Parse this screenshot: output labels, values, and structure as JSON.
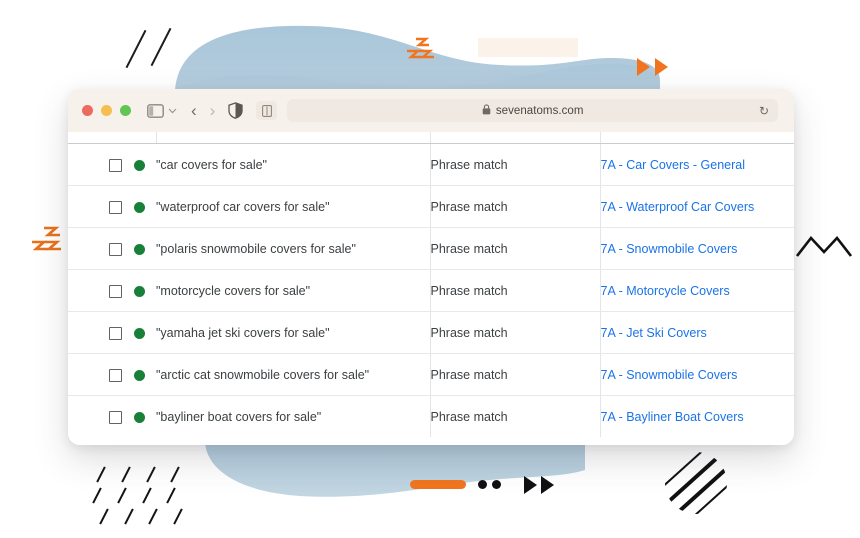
{
  "browser": {
    "traffic_lights": [
      "close",
      "minimize",
      "zoom"
    ],
    "sidebar_toggle_icon": "sidebar-icon",
    "chevron_icon": "chevron-down-icon",
    "back_label": "‹",
    "forward_label": "›",
    "shield_icon": "shield-icon",
    "reader_icon": "reader-mode-icon",
    "lock_icon": "lock-icon",
    "url": "sevenatoms.com",
    "reload_label": "↻"
  },
  "table": {
    "columns": [
      "checkbox",
      "status",
      "keyword",
      "match_type",
      "ad_group"
    ],
    "rows": [
      {
        "keyword": "\"car covers for sale\"",
        "match_type": "Phrase match",
        "ad_group": "7A - Car Covers - General",
        "status": "enabled",
        "checked": false
      },
      {
        "keyword": "\"waterproof car covers for sale\"",
        "match_type": "Phrase match",
        "ad_group": "7A - Waterproof Car Covers",
        "status": "enabled",
        "checked": false
      },
      {
        "keyword": "\"polaris snowmobile covers for sale\"",
        "match_type": "Phrase match",
        "ad_group": "7A - Snowmobile Covers",
        "status": "enabled",
        "checked": false
      },
      {
        "keyword": "\"motorcycle covers for sale\"",
        "match_type": "Phrase match",
        "ad_group": "7A - Motorcycle Covers",
        "status": "enabled",
        "checked": false
      },
      {
        "keyword": "\"yamaha jet ski covers for sale\"",
        "match_type": "Phrase match",
        "ad_group": "7A - Jet Ski Covers",
        "status": "enabled",
        "checked": false
      },
      {
        "keyword": "\"arctic cat snowmobile covers for sale\"",
        "match_type": "Phrase match",
        "ad_group": "7A - Snowmobile Covers",
        "status": "enabled",
        "checked": false
      },
      {
        "keyword": "\"bayliner boat covers for sale\"",
        "match_type": "Phrase match",
        "ad_group": "7A - Bayliner Boat Covers",
        "status": "enabled",
        "checked": false
      }
    ]
  },
  "colors": {
    "link": "#1a73e8",
    "status_enabled": "#188038",
    "accent_orange": "#f1751f",
    "blob_blue": "#a6c4d8",
    "chrome_beige": "#f6f1ea"
  }
}
